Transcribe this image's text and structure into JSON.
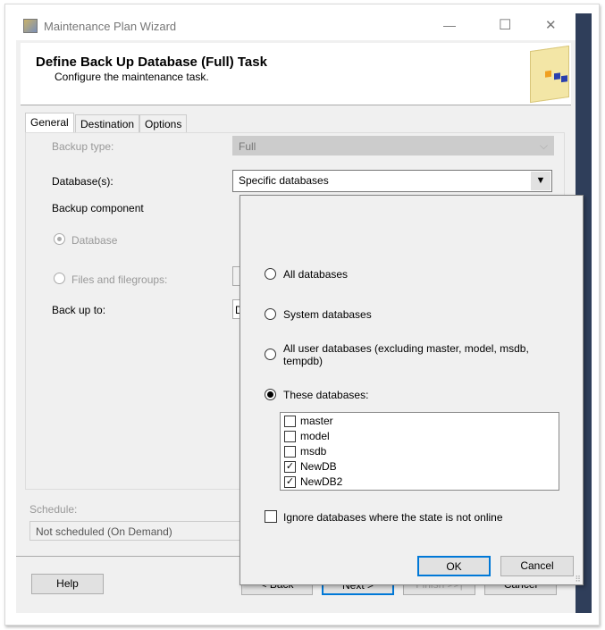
{
  "window": {
    "title": "Maintenance Plan Wizard",
    "minimize": "—",
    "maximize": "☐",
    "close": "✕"
  },
  "header": {
    "title": "Define Back Up Database (Full) Task",
    "subtitle": "Configure the maintenance task."
  },
  "tabs": [
    {
      "label": "General",
      "active": true
    },
    {
      "label": "Destination"
    },
    {
      "label": "Options"
    }
  ],
  "general": {
    "backup_type_label": "Backup type:",
    "backup_type_value": "Full",
    "databases_label": "Database(s):",
    "databases_value": "Specific databases",
    "backup_component_label": "Backup component",
    "component_database": "Database",
    "component_files": "Files and filegroups:",
    "back_up_to_label": "Back up to:",
    "back_up_to_value": "D"
  },
  "schedule": {
    "label": "Schedule:",
    "value": "Not scheduled (On Demand)"
  },
  "footer": {
    "help": "Help",
    "back": "< Back",
    "next": "Next >",
    "finish": "Finish >>|",
    "cancel": "Cancel"
  },
  "popup": {
    "options": [
      {
        "label": "All databases",
        "selected": false
      },
      {
        "label": "System databases",
        "selected": false
      },
      {
        "label": "All user databases  (excluding master, model, msdb, tempdb)",
        "selected": false
      },
      {
        "label": "These databases:",
        "selected": true
      }
    ],
    "databases": [
      {
        "name": "master",
        "checked": false
      },
      {
        "name": "model",
        "checked": false
      },
      {
        "name": "msdb",
        "checked": false
      },
      {
        "name": "NewDB",
        "checked": true
      },
      {
        "name": "NewDB2",
        "checked": true
      }
    ],
    "ignore_offline": {
      "label": "Ignore databases where the state is not online",
      "checked": false
    },
    "ok": "OK",
    "cancel": "Cancel"
  }
}
